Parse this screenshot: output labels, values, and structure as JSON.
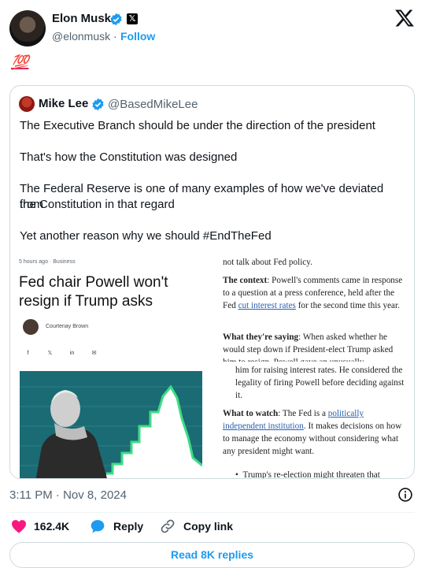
{
  "author": {
    "name": "Elon Musk",
    "handle": "@elonmusk",
    "separator": "·",
    "follow_label": "Follow",
    "badge_letter": "𝕏"
  },
  "tweet_text": "💯",
  "quote": {
    "name": "Mike Lee",
    "handle": "@BasedMikeLee",
    "lines": [
      "The Executive Branch should be under the direction of the president",
      "That's how the Constitution was designed",
      "The Federal Reserve is one of many examples of how we've deviated from",
      "the Constitution in that regard",
      "Yet another reason why we should #EndTheFed"
    ],
    "article": {
      "meta": "5 hours ago · Business",
      "title": "Fed chair Powell won't resign if Trump asks",
      "author": "Courtenay Brown",
      "share_icons": [
        "f",
        "𝕏",
        "in",
        "✉"
      ],
      "col_top": "not talk about Fed policy.",
      "context_label": "The context",
      "context_text": ": Powell's comments came in response to a question at a press conference, held after the Fed ",
      "context_link": "cut interest rates",
      "context_tail": " for the second time this year.",
      "saying_label": "What they're saying",
      "saying_text": ": When asked whether he would step down if President-elect Trump asked him to resign, Powell gave an unusually",
      "saying_cont": "him for raising interest rates. He considered the legality of firing Powell before deciding against it.",
      "watch_label": "What to watch",
      "watch_text": ": The Fed is a ",
      "watch_link": "politically independent institution",
      "watch_tail": ". It makes decisions on how to manage the economy without considering what any president might want.",
      "bullet": "Trump's re-election might threaten that"
    }
  },
  "timestamp": "3:11 PM · Nov 8, 2024",
  "actions": {
    "likes": "162.4K",
    "reply_label": "Reply",
    "copy_label": "Copy link"
  },
  "read_replies_label": "Read 8K replies",
  "colors": {
    "accent": "#1d9bf0",
    "like": "#f91880",
    "chart_bg": "#1a6b74",
    "chart_line": "#3ddc84"
  }
}
